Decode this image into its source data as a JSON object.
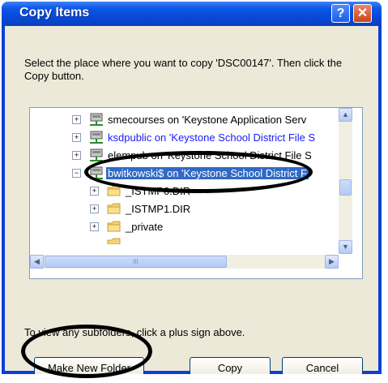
{
  "window": {
    "title": "Copy Items",
    "help_label": "?",
    "close_label": "✕"
  },
  "instructions": "Select the place where you want to copy 'DSC00147'. Then click the Copy button.",
  "tree": {
    "items": [
      {
        "label": "smecourses on 'Keystone Application Serv",
        "expand": "+",
        "icon": "network-drive-icon",
        "style": "normal"
      },
      {
        "label": "ksdpublic on 'Keystone School District File S",
        "expand": "+",
        "icon": "network-drive-icon",
        "style": "blue"
      },
      {
        "label": "elempub on 'Keystone School District File S",
        "expand": "+",
        "icon": "network-drive-icon",
        "style": "normal"
      },
      {
        "label": "bwitkowski$ on 'Keystone School District F",
        "expand": "−",
        "icon": "network-drive-icon",
        "style": "selected"
      },
      {
        "label": "_ISTMP0.DIR",
        "expand": "+",
        "icon": "folder-icon",
        "style": "normal"
      },
      {
        "label": "_ISTMP1.DIR",
        "expand": "+",
        "icon": "folder-icon",
        "style": "normal"
      },
      {
        "label": "_private",
        "expand": "+",
        "icon": "folder-icon",
        "style": "normal"
      }
    ]
  },
  "scroll": {
    "up": "▲",
    "down": "▼",
    "left": "◀",
    "right": "▶",
    "grip": "III"
  },
  "hint": "To view any subfolders, click a plus sign above.",
  "buttons": {
    "make_new_folder_u": "M",
    "make_new_folder_rest": "ake New Folder",
    "copy": "Copy",
    "cancel": "Cancel"
  },
  "colors": {
    "title_bar": "#0a3fd8",
    "selection": "#316ac5",
    "dialog_bg": "#ece9d8",
    "annotation_ovals": "#000000"
  }
}
